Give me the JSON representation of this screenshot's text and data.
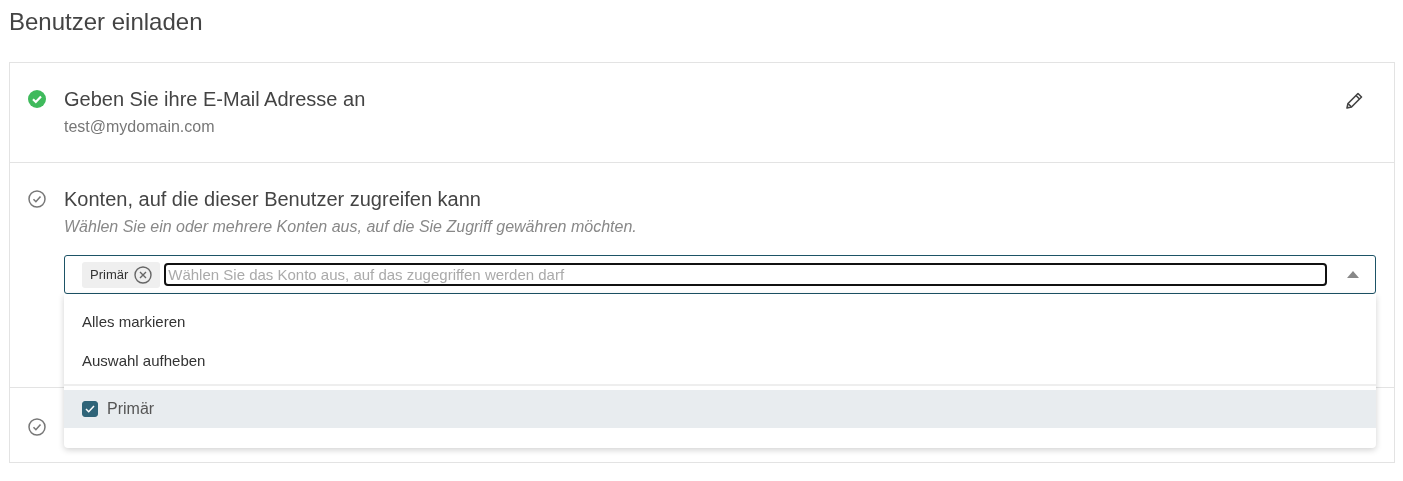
{
  "page_title": "Benutzer einladen",
  "steps": [
    {
      "completed": true,
      "title": "Geben Sie ihre E-Mail Adresse an",
      "value": "test@mydomain.com",
      "editable": true
    },
    {
      "completed": false,
      "title": "Konten, auf die dieser Benutzer zugreifen kann",
      "hint": "Wählen Sie ein oder mehrere Konten aus, auf die Sie Zugriff gewähren möchten.",
      "multiselect": {
        "chips": [
          "Primär"
        ],
        "placeholder": "Wählen Sie das Konto aus, auf das zugegriffen werden darf",
        "expanded": true,
        "actions": [
          "Alles markieren",
          "Auswahl aufheben"
        ],
        "options": [
          {
            "label": "Primär",
            "checked": true,
            "selected": true
          }
        ]
      }
    },
    {
      "completed": false
    }
  ]
}
